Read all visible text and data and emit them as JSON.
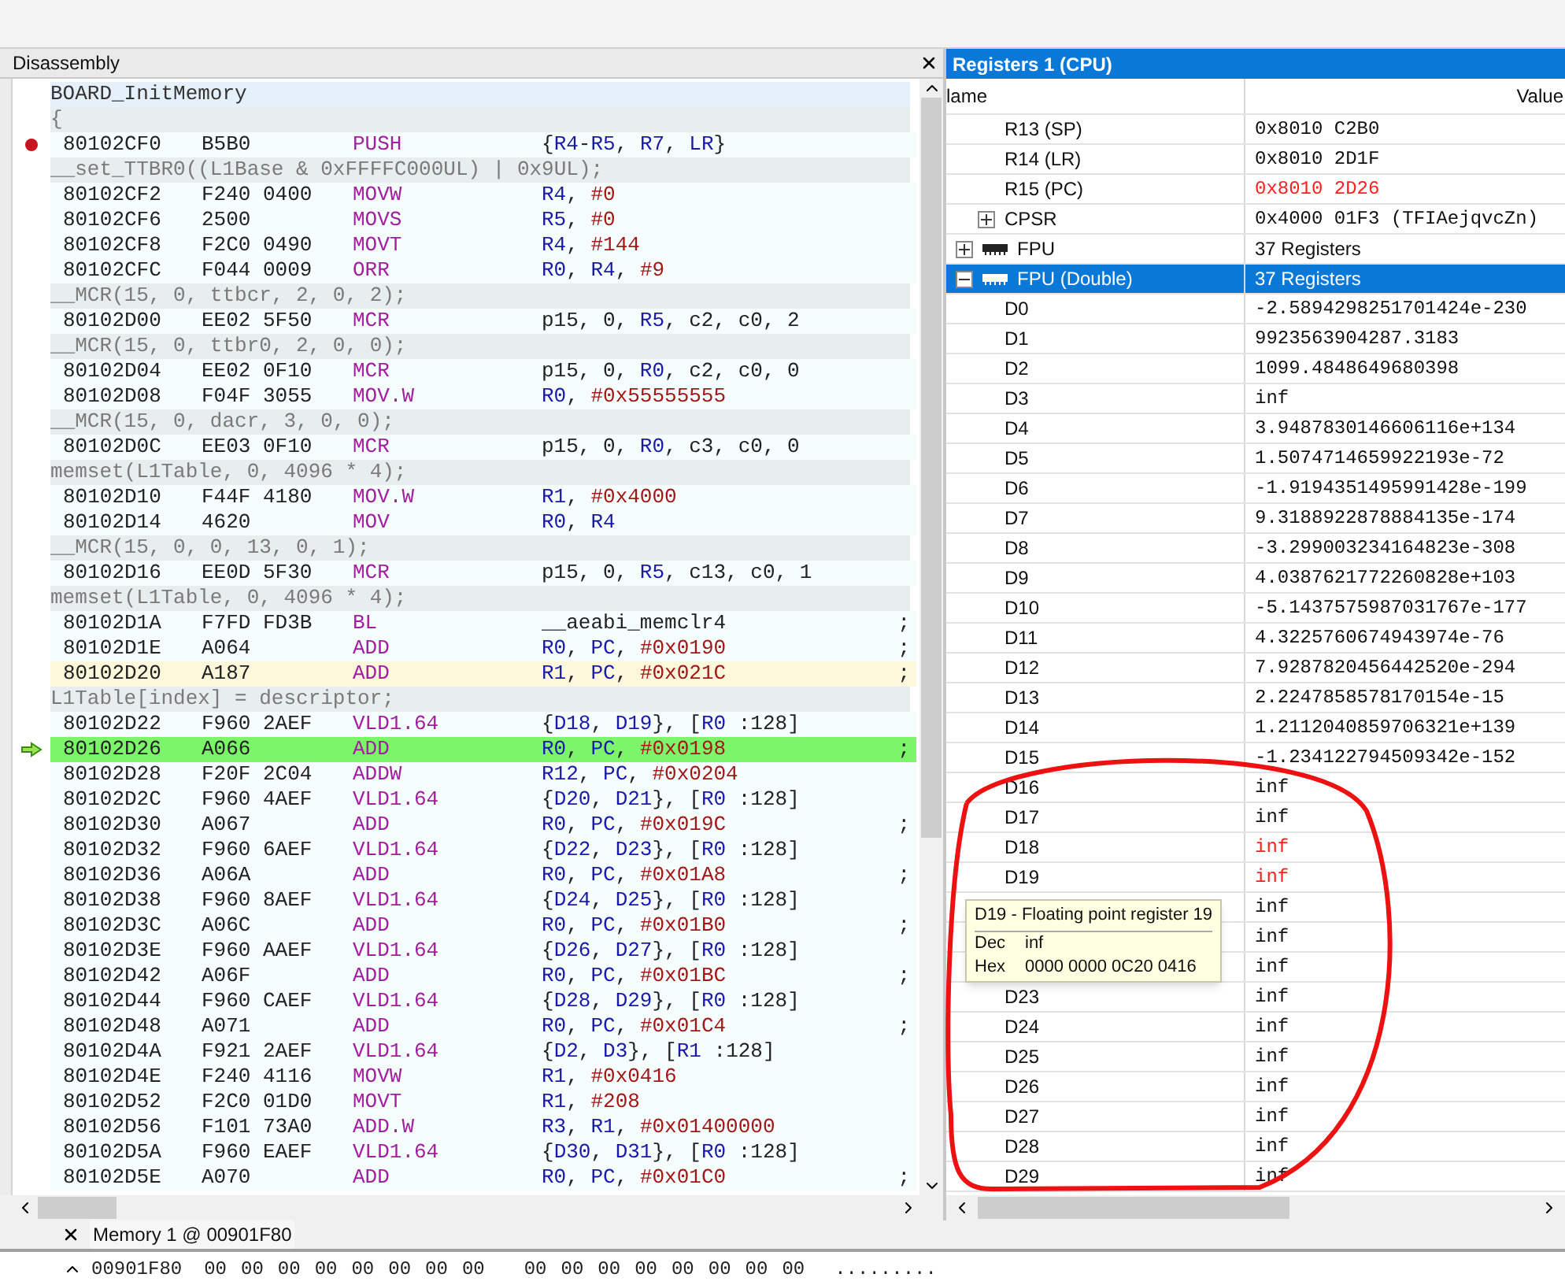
{
  "disassembly": {
    "title": "Disassembly",
    "rows": [
      {
        "kind": "label",
        "text": "BOARD_InitMemory"
      },
      {
        "kind": "source",
        "text": "{"
      },
      {
        "kind": "instr",
        "address": "80102CF0",
        "code": "B5B0",
        "mnemonic": "PUSH",
        "operands": "{R4-R5, R7, LR}",
        "breakpoint": true,
        "current": false,
        "highlighted": false
      },
      {
        "kind": "source",
        "text": "__set_TTBR0((L1Base & 0xFFFFC000UL) | 0x9UL);"
      },
      {
        "kind": "instr",
        "address": "80102CF2",
        "code": "F240 0400",
        "mnemonic": "MOVW",
        "operands": "R4, #0",
        "breakpoint": false,
        "current": false,
        "highlighted": false
      },
      {
        "kind": "instr",
        "address": "80102CF6",
        "code": "2500",
        "mnemonic": "MOVS",
        "operands": "R5, #0",
        "breakpoint": false,
        "current": false,
        "highlighted": false
      },
      {
        "kind": "instr",
        "address": "80102CF8",
        "code": "F2C0 0490",
        "mnemonic": "MOVT",
        "operands": "R4, #144",
        "breakpoint": false,
        "current": false,
        "highlighted": false
      },
      {
        "kind": "instr",
        "address": "80102CFC",
        "code": "F044 0009",
        "mnemonic": "ORR",
        "operands": "R0, R4, #9",
        "breakpoint": false,
        "current": false,
        "highlighted": false
      },
      {
        "kind": "source",
        "text": "__MCR(15, 0, ttbcr, 2, 0, 2);"
      },
      {
        "kind": "instr",
        "address": "80102D00",
        "code": "EE02 5F50",
        "mnemonic": "MCR",
        "operands": "p15, 0, R5, c2, c0, 2",
        "breakpoint": false,
        "current": false,
        "highlighted": false
      },
      {
        "kind": "source",
        "text": "__MCR(15, 0, ttbr0, 2, 0, 0);"
      },
      {
        "kind": "instr",
        "address": "80102D04",
        "code": "EE02 0F10",
        "mnemonic": "MCR",
        "operands": "p15, 0, R0, c2, c0, 0",
        "breakpoint": false,
        "current": false,
        "highlighted": false
      },
      {
        "kind": "instr",
        "address": "80102D08",
        "code": "F04F 3055",
        "mnemonic": "MOV.W",
        "operands": "R0, #0x55555555",
        "breakpoint": false,
        "current": false,
        "highlighted": false
      },
      {
        "kind": "source",
        "text": "__MCR(15, 0, dacr, 3, 0, 0);"
      },
      {
        "kind": "instr",
        "address": "80102D0C",
        "code": "EE03 0F10",
        "mnemonic": "MCR",
        "operands": "p15, 0, R0, c3, c0, 0",
        "breakpoint": false,
        "current": false,
        "highlighted": false
      },
      {
        "kind": "source",
        "text": "memset(L1Table, 0, 4096 * 4);"
      },
      {
        "kind": "instr",
        "address": "80102D10",
        "code": "F44F 4180",
        "mnemonic": "MOV.W",
        "operands": "R1, #0x4000",
        "breakpoint": false,
        "current": false,
        "highlighted": false
      },
      {
        "kind": "instr",
        "address": "80102D14",
        "code": "4620",
        "mnemonic": "MOV",
        "operands": "R0, R4",
        "breakpoint": false,
        "current": false,
        "highlighted": false
      },
      {
        "kind": "source",
        "text": "__MCR(15, 0, 0, 13, 0, 1);"
      },
      {
        "kind": "instr",
        "address": "80102D16",
        "code": "EE0D 5F30",
        "mnemonic": "MCR",
        "operands": "p15, 0, R5, c13, c0, 1",
        "breakpoint": false,
        "current": false,
        "highlighted": false
      },
      {
        "kind": "source",
        "text": "memset(L1Table, 0, 4096 * 4);"
      },
      {
        "kind": "instr",
        "address": "80102D1A",
        "code": "F7FD FD3B",
        "mnemonic": "BL",
        "operands": "__aeabi_memclr4",
        "comment": ";",
        "breakpoint": false,
        "current": false,
        "highlighted": false
      },
      {
        "kind": "instr",
        "address": "80102D1E",
        "code": "A064",
        "mnemonic": "ADD",
        "operands": "R0, PC, #0x0190",
        "comment": ";",
        "breakpoint": false,
        "current": false,
        "highlighted": false
      },
      {
        "kind": "instr",
        "address": "80102D20",
        "code": "A187",
        "mnemonic": "ADD",
        "operands": "R1, PC, #0x021C",
        "comment": ";",
        "breakpoint": false,
        "current": false,
        "highlighted": true
      },
      {
        "kind": "source",
        "text": "L1Table[index] = descriptor;"
      },
      {
        "kind": "instr",
        "address": "80102D22",
        "code": "F960 2AEF",
        "mnemonic": "VLD1.64",
        "operands": "{D18, D19}, [R0 :128]",
        "breakpoint": false,
        "current": false,
        "highlighted": false
      },
      {
        "kind": "instr",
        "address": "80102D26",
        "code": "A066",
        "mnemonic": "ADD",
        "operands": "R0, PC, #0x0198",
        "comment": ";",
        "breakpoint": false,
        "current": true,
        "highlighted": false
      },
      {
        "kind": "instr",
        "address": "80102D28",
        "code": "F20F 2C04",
        "mnemonic": "ADDW",
        "operands": "R12, PC, #0x0204",
        "breakpoint": false,
        "current": false,
        "highlighted": false
      },
      {
        "kind": "instr",
        "address": "80102D2C",
        "code": "F960 4AEF",
        "mnemonic": "VLD1.64",
        "operands": "{D20, D21}, [R0 :128]",
        "breakpoint": false,
        "current": false,
        "highlighted": false
      },
      {
        "kind": "instr",
        "address": "80102D30",
        "code": "A067",
        "mnemonic": "ADD",
        "operands": "R0, PC, #0x019C",
        "comment": ";",
        "breakpoint": false,
        "current": false,
        "highlighted": false
      },
      {
        "kind": "instr",
        "address": "80102D32",
        "code": "F960 6AEF",
        "mnemonic": "VLD1.64",
        "operands": "{D22, D23}, [R0 :128]",
        "breakpoint": false,
        "current": false,
        "highlighted": false
      },
      {
        "kind": "instr",
        "address": "80102D36",
        "code": "A06A",
        "mnemonic": "ADD",
        "operands": "R0, PC, #0x01A8",
        "comment": ";",
        "breakpoint": false,
        "current": false,
        "highlighted": false
      },
      {
        "kind": "instr",
        "address": "80102D38",
        "code": "F960 8AEF",
        "mnemonic": "VLD1.64",
        "operands": "{D24, D25}, [R0 :128]",
        "breakpoint": false,
        "current": false,
        "highlighted": false
      },
      {
        "kind": "instr",
        "address": "80102D3C",
        "code": "A06C",
        "mnemonic": "ADD",
        "operands": "R0, PC, #0x01B0",
        "comment": ";",
        "breakpoint": false,
        "current": false,
        "highlighted": false
      },
      {
        "kind": "instr",
        "address": "80102D3E",
        "code": "F960 AAEF",
        "mnemonic": "VLD1.64",
        "operands": "{D26, D27}, [R0 :128]",
        "breakpoint": false,
        "current": false,
        "highlighted": false
      },
      {
        "kind": "instr",
        "address": "80102D42",
        "code": "A06F",
        "mnemonic": "ADD",
        "operands": "R0, PC, #0x01BC",
        "comment": ";",
        "breakpoint": false,
        "current": false,
        "highlighted": false
      },
      {
        "kind": "instr",
        "address": "80102D44",
        "code": "F960 CAEF",
        "mnemonic": "VLD1.64",
        "operands": "{D28, D29}, [R0 :128]",
        "breakpoint": false,
        "current": false,
        "highlighted": false
      },
      {
        "kind": "instr",
        "address": "80102D48",
        "code": "A071",
        "mnemonic": "ADD",
        "operands": "R0, PC, #0x01C4",
        "comment": ";",
        "breakpoint": false,
        "current": false,
        "highlighted": false
      },
      {
        "kind": "instr",
        "address": "80102D4A",
        "code": "F921 2AEF",
        "mnemonic": "VLD1.64",
        "operands": "{D2, D3}, [R1 :128]",
        "breakpoint": false,
        "current": false,
        "highlighted": false
      },
      {
        "kind": "instr",
        "address": "80102D4E",
        "code": "F240 4116",
        "mnemonic": "MOVW",
        "operands": "R1, #0x0416",
        "breakpoint": false,
        "current": false,
        "highlighted": false
      },
      {
        "kind": "instr",
        "address": "80102D52",
        "code": "F2C0 01D0",
        "mnemonic": "MOVT",
        "operands": "R1, #208",
        "breakpoint": false,
        "current": false,
        "highlighted": false
      },
      {
        "kind": "instr",
        "address": "80102D56",
        "code": "F101 73A0",
        "mnemonic": "ADD.W",
        "operands": "R3, R1, #0x01400000",
        "breakpoint": false,
        "current": false,
        "highlighted": false
      },
      {
        "kind": "instr",
        "address": "80102D5A",
        "code": "F960 EAEF",
        "mnemonic": "VLD1.64",
        "operands": "{D30, D31}, [R0 :128]",
        "breakpoint": false,
        "current": false,
        "highlighted": false
      },
      {
        "kind": "instr",
        "address": "80102D5E",
        "code": "A070",
        "mnemonic": "ADD",
        "operands": "R0, PC, #0x01C0",
        "comment": ";",
        "breakpoint": false,
        "current": false,
        "highlighted": false
      }
    ]
  },
  "registers": {
    "title": "Registers 1 (CPU)",
    "columns": [
      "lame",
      "Value"
    ],
    "rows": [
      {
        "kind": "reg",
        "name": "R13 (SP)",
        "value": "0x8010 C2B0",
        "changed": false,
        "selected": false
      },
      {
        "kind": "reg",
        "name": "R14 (LR)",
        "value": "0x8010 2D1F",
        "changed": false,
        "selected": false
      },
      {
        "kind": "reg",
        "name": "R15 (PC)",
        "value": "0x8010 2D26",
        "changed": true,
        "selected": false
      },
      {
        "kind": "flags",
        "name": "CPSR",
        "value": "0x4000 01F3 (TFIAejqvcZn)",
        "changed": false,
        "selected": false,
        "expanded": false
      },
      {
        "kind": "bank",
        "name": "FPU",
        "value": "37 Registers",
        "changed": false,
        "selected": false,
        "expanded": false
      },
      {
        "kind": "bank",
        "name": "FPU (Double)",
        "value": "37 Registers",
        "changed": false,
        "selected": true,
        "expanded": true,
        "children": [
          {
            "kind": "reg",
            "name": "D0",
            "value": "-2.5894298251701424e-230",
            "changed": false,
            "selected": false
          },
          {
            "kind": "reg",
            "name": "D1",
            "value": "9923563904287.3183",
            "changed": false,
            "selected": false
          },
          {
            "kind": "reg",
            "name": "D2",
            "value": "1099.4848649680398",
            "changed": false,
            "selected": false
          },
          {
            "kind": "reg",
            "name": "D3",
            "value": "inf",
            "changed": false,
            "selected": false
          },
          {
            "kind": "reg",
            "name": "D4",
            "value": "3.9487830146606116e+134",
            "changed": false,
            "selected": false
          },
          {
            "kind": "reg",
            "name": "D5",
            "value": "1.5074714659922193e-72",
            "changed": false,
            "selected": false
          },
          {
            "kind": "reg",
            "name": "D6",
            "value": "-1.9194351495991428e-199",
            "changed": false,
            "selected": false
          },
          {
            "kind": "reg",
            "name": "D7",
            "value": "9.3188922878884135e-174",
            "changed": false,
            "selected": false
          },
          {
            "kind": "reg",
            "name": "D8",
            "value": "-3.299003234164823e-308",
            "changed": false,
            "selected": false
          },
          {
            "kind": "reg",
            "name": "D9",
            "value": "4.0387621772260828e+103",
            "changed": false,
            "selected": false
          },
          {
            "kind": "reg",
            "name": "D10",
            "value": "-5.1437575987031767e-177",
            "changed": false,
            "selected": false
          },
          {
            "kind": "reg",
            "name": "D11",
            "value": "4.3225760674943974e-76",
            "changed": false,
            "selected": false
          },
          {
            "kind": "reg",
            "name": "D12",
            "value": "7.9287820456442520e-294",
            "changed": false,
            "selected": false
          },
          {
            "kind": "reg",
            "name": "D13",
            "value": "2.2247858578170154e-15",
            "changed": false,
            "selected": false
          },
          {
            "kind": "reg",
            "name": "D14",
            "value": "1.2112040859706321e+139",
            "changed": false,
            "selected": false
          },
          {
            "kind": "reg",
            "name": "D15",
            "value": "-1.234122794509342e-152",
            "changed": false,
            "selected": false
          },
          {
            "kind": "reg",
            "name": "D16",
            "value": "inf",
            "changed": false,
            "selected": false
          },
          {
            "kind": "reg",
            "name": "D17",
            "value": "inf",
            "changed": false,
            "selected": false
          },
          {
            "kind": "reg",
            "name": "D18",
            "value": "inf",
            "changed": true,
            "selected": false
          },
          {
            "kind": "reg",
            "name": "D19",
            "value": "inf",
            "changed": true,
            "selected": false
          },
          {
            "kind": "reg",
            "value": "inf",
            "changed": false,
            "selected": false
          },
          {
            "kind": "reg",
            "value": "inf",
            "changed": false,
            "selected": false
          },
          {
            "kind": "reg",
            "value": "inf",
            "changed": false,
            "selected": false
          },
          {
            "kind": "reg",
            "name": "D23",
            "value": "inf",
            "changed": false,
            "selected": false
          },
          {
            "kind": "reg",
            "name": "D24",
            "value": "inf",
            "changed": false,
            "selected": false
          },
          {
            "kind": "reg",
            "name": "D25",
            "value": "inf",
            "changed": false,
            "selected": false
          },
          {
            "kind": "reg",
            "name": "D26",
            "value": "inf",
            "changed": false,
            "selected": false
          },
          {
            "kind": "reg",
            "name": "D27",
            "value": "inf",
            "changed": false,
            "selected": false
          },
          {
            "kind": "reg",
            "name": "D28",
            "value": "inf",
            "changed": false,
            "selected": false
          },
          {
            "kind": "reg",
            "name": "D29",
            "value": "inf",
            "changed": false,
            "selected": false
          }
        ]
      }
    ]
  },
  "tooltip": {
    "title": "D19 - Floating point register 19",
    "lines": [
      {
        "label": "Dec",
        "value": "inf"
      },
      {
        "label": "Hex",
        "value": "0000 0000 0C20 0416"
      }
    ]
  },
  "memory": {
    "tab": "Memory 1 @ 00901F80",
    "address": "00901F80",
    "bytes": [
      "00",
      "00",
      "00",
      "00",
      "00",
      "00",
      "00",
      "00",
      "00",
      "00",
      "00",
      "00",
      "00",
      "00",
      "00",
      "00"
    ],
    "ascii": "........."
  }
}
